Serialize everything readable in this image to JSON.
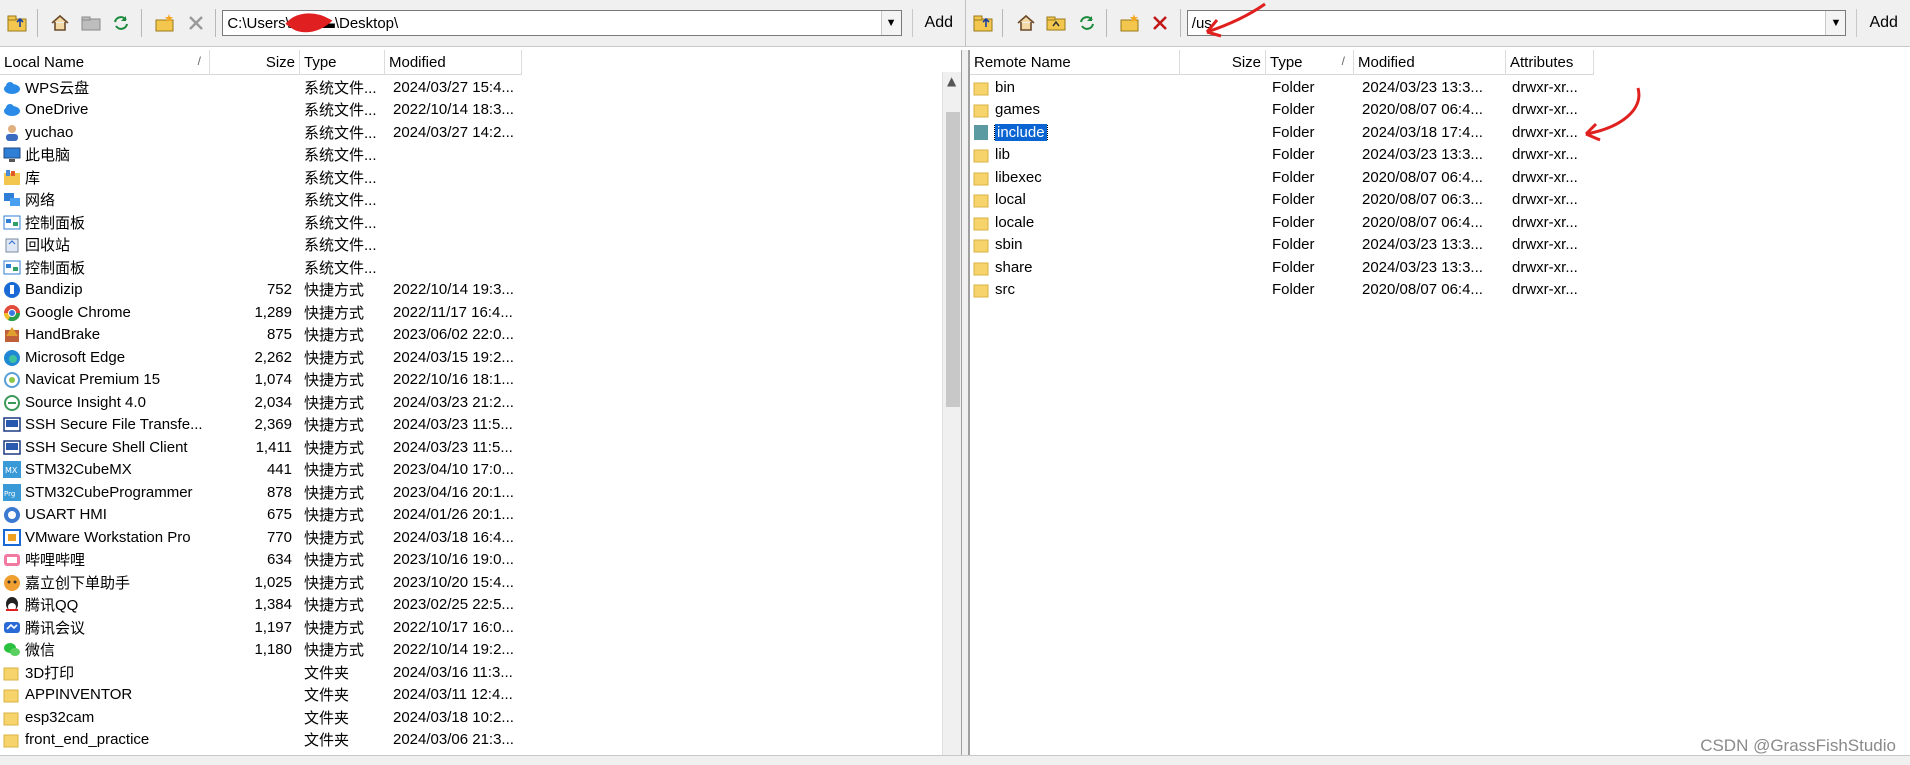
{
  "left_toolbar": {
    "path_value": "C:\\Users\\▬▬▬\\Desktop\\",
    "add_label": "Add"
  },
  "right_toolbar": {
    "path_value": "/us",
    "add_label": "Add"
  },
  "left_columns": {
    "name": "Local Name",
    "sort": "/",
    "size": "Size",
    "type": "Type",
    "modified": "Modified"
  },
  "right_columns": {
    "name": "Remote Name",
    "size": "Size",
    "type": "Type",
    "sort": "/",
    "modified": "Modified",
    "attributes": "Attributes"
  },
  "local_files": [
    {
      "name": "WPS云盘",
      "size": "",
      "type": "系统文件...",
      "modified": "2024/03/27 15:4...",
      "icon": "cloud-icon"
    },
    {
      "name": "OneDrive",
      "size": "",
      "type": "系统文件...",
      "modified": "2022/10/14 18:3...",
      "icon": "cloud-icon"
    },
    {
      "name": "yuchao",
      "size": "",
      "type": "系统文件...",
      "modified": "2024/03/27 14:2...",
      "icon": "user-icon"
    },
    {
      "name": "此电脑",
      "size": "",
      "type": "系统文件...",
      "modified": "",
      "icon": "computer-icon"
    },
    {
      "name": "库",
      "size": "",
      "type": "系统文件...",
      "modified": "",
      "icon": "library-icon"
    },
    {
      "name": "网络",
      "size": "",
      "type": "系统文件...",
      "modified": "",
      "icon": "network-icon"
    },
    {
      "name": "控制面板",
      "size": "",
      "type": "系统文件...",
      "modified": "",
      "icon": "control-panel-icon"
    },
    {
      "name": "回收站",
      "size": "",
      "type": "系统文件...",
      "modified": "",
      "icon": "recycle-bin-icon"
    },
    {
      "name": "控制面板",
      "size": "",
      "type": "系统文件...",
      "modified": "",
      "icon": "control-panel-icon"
    },
    {
      "name": "Bandizip",
      "size": "752",
      "type": "快捷方式",
      "modified": "2022/10/14 19:3...",
      "icon": "bandizip-icon"
    },
    {
      "name": "Google Chrome",
      "size": "1,289",
      "type": "快捷方式",
      "modified": "2022/11/17 16:4...",
      "icon": "chrome-icon"
    },
    {
      "name": "HandBrake",
      "size": "875",
      "type": "快捷方式",
      "modified": "2023/06/02 22:0...",
      "icon": "handbrake-icon"
    },
    {
      "name": "Microsoft Edge",
      "size": "2,262",
      "type": "快捷方式",
      "modified": "2024/03/15 19:2...",
      "icon": "edge-icon"
    },
    {
      "name": "Navicat Premium 15",
      "size": "1,074",
      "type": "快捷方式",
      "modified": "2022/10/16 18:1...",
      "icon": "navicat-icon"
    },
    {
      "name": "Source Insight 4.0",
      "size": "2,034",
      "type": "快捷方式",
      "modified": "2024/03/23 21:2...",
      "icon": "source-insight-icon"
    },
    {
      "name": "SSH Secure File Transfe...",
      "size": "2,369",
      "type": "快捷方式",
      "modified": "2024/03/23 11:5...",
      "icon": "ssh-icon"
    },
    {
      "name": "SSH Secure Shell Client",
      "size": "1,411",
      "type": "快捷方式",
      "modified": "2024/03/23 11:5...",
      "icon": "ssh-icon"
    },
    {
      "name": "STM32CubeMX",
      "size": "441",
      "type": "快捷方式",
      "modified": "2023/04/10 17:0...",
      "icon": "cubemx-icon"
    },
    {
      "name": "STM32CubeProgrammer",
      "size": "878",
      "type": "快捷方式",
      "modified": "2023/04/16 20:1...",
      "icon": "cubeprogrammer-icon"
    },
    {
      "name": "USART HMI",
      "size": "675",
      "type": "快捷方式",
      "modified": "2024/01/26 20:1...",
      "icon": "usart-hmi-icon"
    },
    {
      "name": "VMware Workstation Pro",
      "size": "770",
      "type": "快捷方式",
      "modified": "2024/03/18 16:4...",
      "icon": "vmware-icon"
    },
    {
      "name": "哔哩哔哩",
      "size": "634",
      "type": "快捷方式",
      "modified": "2023/10/16 19:0...",
      "icon": "bilibili-icon"
    },
    {
      "name": "嘉立创下单助手",
      "size": "1,025",
      "type": "快捷方式",
      "modified": "2023/10/20 15:4...",
      "icon": "jlc-icon"
    },
    {
      "name": "腾讯QQ",
      "size": "1,384",
      "type": "快捷方式",
      "modified": "2023/02/25 22:5...",
      "icon": "qq-icon"
    },
    {
      "name": "腾讯会议",
      "size": "1,197",
      "type": "快捷方式",
      "modified": "2022/10/17 16:0...",
      "icon": "tencent-meeting-icon"
    },
    {
      "name": "微信",
      "size": "1,180",
      "type": "快捷方式",
      "modified": "2022/10/14 19:2...",
      "icon": "wechat-icon"
    },
    {
      "name": "3D打印",
      "size": "",
      "type": "文件夹",
      "modified": "2024/03/16 11:3...",
      "icon": "folder-icon"
    },
    {
      "name": "APPINVENTOR",
      "size": "",
      "type": "文件夹",
      "modified": "2024/03/11 12:4...",
      "icon": "folder-icon"
    },
    {
      "name": "esp32cam",
      "size": "",
      "type": "文件夹",
      "modified": "2024/03/18 10:2...",
      "icon": "folder-icon"
    },
    {
      "name": "front_end_practice",
      "size": "",
      "type": "文件夹",
      "modified": "2024/03/06 21:3...",
      "icon": "folder-icon"
    }
  ],
  "remote_files": [
    {
      "name": "bin",
      "size": "",
      "type": "Folder",
      "modified": "2024/03/23 13:3...",
      "attributes": "drwxr-xr..."
    },
    {
      "name": "games",
      "size": "",
      "type": "Folder",
      "modified": "2020/08/07 06:4...",
      "attributes": "drwxr-xr..."
    },
    {
      "name": "include",
      "size": "",
      "type": "Folder",
      "modified": "2024/03/18 17:4...",
      "attributes": "drwxr-xr..."
    },
    {
      "name": "lib",
      "size": "",
      "type": "Folder",
      "modified": "2024/03/23 13:3...",
      "attributes": "drwxr-xr..."
    },
    {
      "name": "libexec",
      "size": "",
      "type": "Folder",
      "modified": "2020/08/07 06:4...",
      "attributes": "drwxr-xr..."
    },
    {
      "name": "local",
      "size": "",
      "type": "Folder",
      "modified": "2020/08/07 06:3...",
      "attributes": "drwxr-xr..."
    },
    {
      "name": "locale",
      "size": "",
      "type": "Folder",
      "modified": "2020/08/07 06:4...",
      "attributes": "drwxr-xr..."
    },
    {
      "name": "sbin",
      "size": "",
      "type": "Folder",
      "modified": "2024/03/23 13:3...",
      "attributes": "drwxr-xr..."
    },
    {
      "name": "share",
      "size": "",
      "type": "Folder",
      "modified": "2024/03/23 13:3...",
      "attributes": "drwxr-xr..."
    },
    {
      "name": "src",
      "size": "",
      "type": "Folder",
      "modified": "2020/08/07 06:4...",
      "attributes": "drwxr-xr..."
    }
  ],
  "selected_remote_index": 2,
  "watermark": "CSDN @GrassFishStudio",
  "colors": {
    "selection": "#0a64d2",
    "annotation": "#e0201e",
    "folder": "#f6d36b"
  }
}
